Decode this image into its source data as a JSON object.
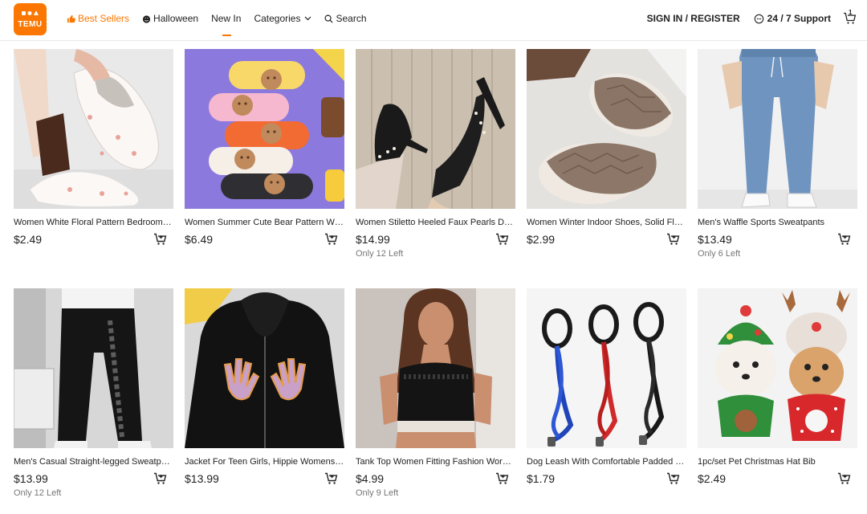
{
  "brand": {
    "name": "TEMU",
    "logo_glyphs": "🛍 👗",
    "accent": "#fb7701"
  },
  "nav": {
    "best_sellers": "Best Sellers",
    "halloween": "Halloween",
    "new_in": "New In",
    "categories": "Categories",
    "search": "Search"
  },
  "account": {
    "signin": "SIGN IN / REGISTER",
    "support": "24 / 7 Support",
    "cart_count": "1"
  },
  "products": [
    {
      "title": "Women White Floral Pattern Bedroom Slippers",
      "price": "$2.49",
      "stock": "",
      "image": "floral-slipper"
    },
    {
      "title": "Women Summer Cute Bear Pattern Wide Slides",
      "price": "$6.49",
      "stock": "",
      "image": "bear-slides"
    },
    {
      "title": "Women Stiletto Heeled Faux Pearls Decor Pumps",
      "price": "$14.99",
      "stock": "Only 12 Left",
      "image": "stiletto-heels"
    },
    {
      "title": "Women Winter Indoor Shoes, Solid Fluffy Slippers",
      "price": "$2.99",
      "stock": "",
      "image": "fluffy-slippers"
    },
    {
      "title": "Men's Waffle Sports Sweatpants",
      "price": "$13.49",
      "stock": "Only 6 Left",
      "image": "sweatpants"
    },
    {
      "title": "Men's Casual Straight-legged Sweatpants",
      "price": "$13.99",
      "stock": "Only 12 Left",
      "image": "track-pants"
    },
    {
      "title": "Jacket For Teen Girls, Hippie Womens Hoodie",
      "price": "$13.99",
      "stock": "",
      "image": "hand-hoodie"
    },
    {
      "title": "Tank Top Women Fitting Fashion Workout",
      "price": "$4.99",
      "stock": "Only 9 Left",
      "image": "crop-top"
    },
    {
      "title": "Dog Leash With Comfortable Padded Handle",
      "price": "$1.79",
      "stock": "",
      "image": "dog-leashes"
    },
    {
      "title": "1pc/set Pet Christmas Hat Bib",
      "price": "$2.49",
      "stock": "",
      "image": "pet-christmas"
    }
  ]
}
